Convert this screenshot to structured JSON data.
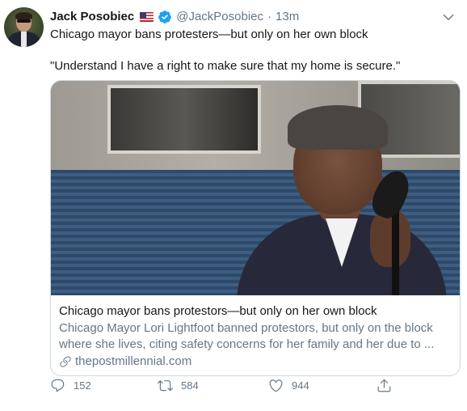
{
  "tweet": {
    "author_name": "Jack Posobiec",
    "handle": "@JackPosobiec",
    "separator": "·",
    "time": "13m",
    "text_line1": "Chicago mayor bans protesters—but only on her own block",
    "text_line2": "\"Understand I have a right to make sure that my home is secure.\""
  },
  "card": {
    "title": "Chicago mayor bans protestors—but only on her own block",
    "description": "Chicago Mayor Lori Lightfoot banned protestors, but only on the block where she lives, citing safety concerns for her family and her due to ...",
    "domain": "thepostmillennial.com"
  },
  "actions": {
    "replies": "152",
    "retweets": "584",
    "likes": "944"
  },
  "icons": {
    "flag": "us-flag-icon",
    "verified": "verified-badge-icon",
    "caret": "chevron-down-icon",
    "link": "link-icon",
    "reply": "reply-icon",
    "retweet": "retweet-icon",
    "like": "heart-icon",
    "share": "share-icon"
  },
  "colors": {
    "primary_text": "#14171a",
    "secondary_text": "#657786",
    "verified_blue": "#1da1f2",
    "border": "#ccd6dd"
  }
}
